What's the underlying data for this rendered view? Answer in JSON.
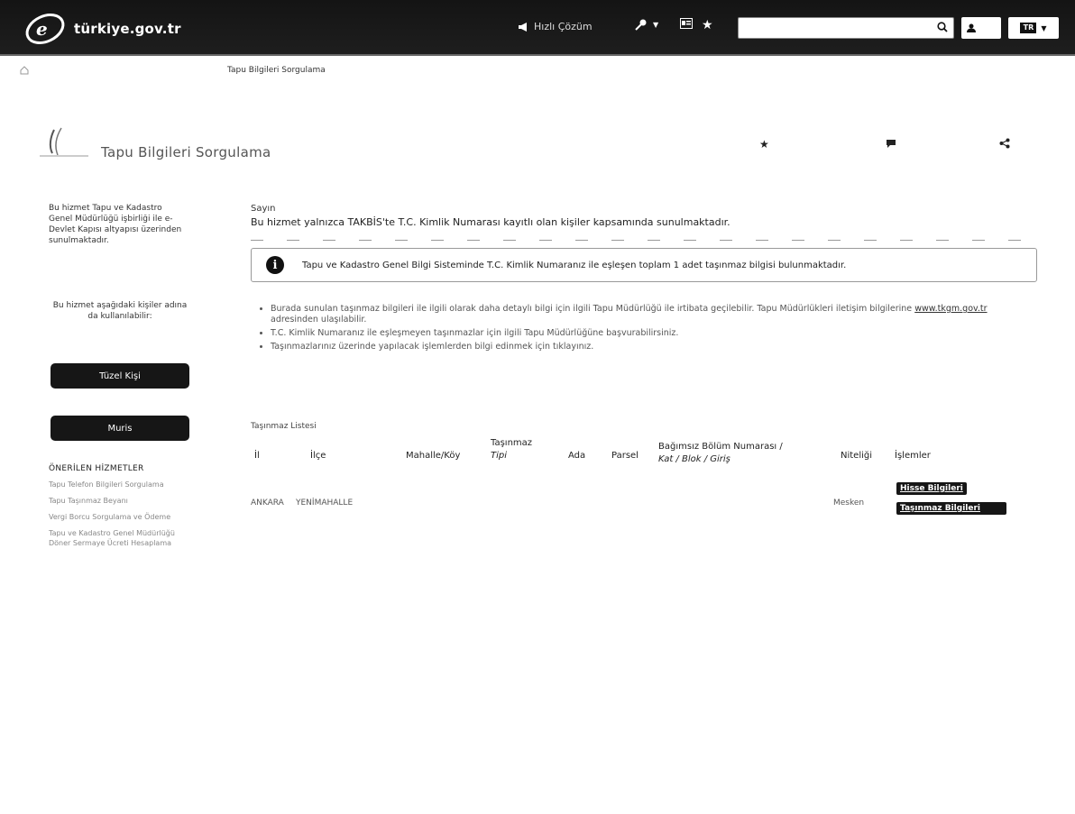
{
  "header": {
    "logo_text": "türkiye.gov.tr",
    "quick_solution": "Hızlı Çözüm",
    "search_placeholder": "",
    "lang": "TR"
  },
  "breadcrumb": {
    "current": "Tapu Bilgileri Sorgulama"
  },
  "page": {
    "title": "Tapu Bilgileri Sorgulama"
  },
  "sidebar": {
    "description": "Bu hizmet Tapu ve Kadastro Genel Müdürlüğü işbirliği ile e-Devlet Kapısı altyapısı üzerinden sunulmaktadır.",
    "note": "Bu hizmet aşağıdaki kişiler adına da kullanılabilir:",
    "btn_tuzel": "Tüzel Kişi",
    "btn_muris": "Muris",
    "onerilen_title": "ÖNERİLEN HİZMETLER",
    "links": [
      "Tapu Telefon Bilgileri Sorgulama",
      "Tapu Taşınmaz Beyanı",
      "Vergi Borcu Sorgulama ve Ödeme",
      "Tapu ve Kadastro Genel Müdürlüğü Döner Sermaye Ücreti Hesaplama"
    ]
  },
  "main": {
    "sayin": "Sayın",
    "info": "Bu hizmet yalnızca TAKBİS'te T.C. Kimlik Numarası kayıtlı olan kişiler kapsamında sunulmaktadır.",
    "alert": "Tapu ve Kadastro Genel Bilgi Sisteminde T.C. Kimlik Numaranız ile eşleşen toplam 1 adet taşınmaz bilgisi bulunmaktadır.",
    "bullet_1": "Burada sunulan taşınmaz bilgileri ile ilgili olarak daha detaylı bilgi için ilgili Tapu Müdürlüğü ile irtibata geçilebilir. Tapu Müdürlükleri iletişim bilgilerine",
    "bullet_1_link": "www.tkgm.gov.tr",
    "bullet_1_tail": "adresinden ulaşılabilir.",
    "bullet_2": "T.C. Kimlik Numaranız ile eşleşmeyen taşınmazlar için ilgili Tapu Müdürlüğüne başvurabilirsiniz.",
    "bullet_3": "Taşınmazlarınız üzerinde yapılacak işlemlerden bilgi edinmek için tıklayınız.",
    "list_label": "Taşınmaz Listesi"
  },
  "table": {
    "columns": [
      "İl",
      "İlçe",
      "Mahalle/Köy",
      "Taşınmaz",
      "Tipi",
      "Ada",
      "Parsel",
      "Bağımsız Bölüm Numarası /",
      "Kat / Blok / Giriş",
      "Niteliği",
      "İşlemler"
    ],
    "rows": [
      {
        "il": "ANKARA",
        "ilce": "YENİMAHALLE",
        "nitelik": "Mesken"
      }
    ],
    "btn_hisse": "Hisse Bilgileri",
    "btn_tasinmaz": "Taşınmaz Bilgileri"
  }
}
